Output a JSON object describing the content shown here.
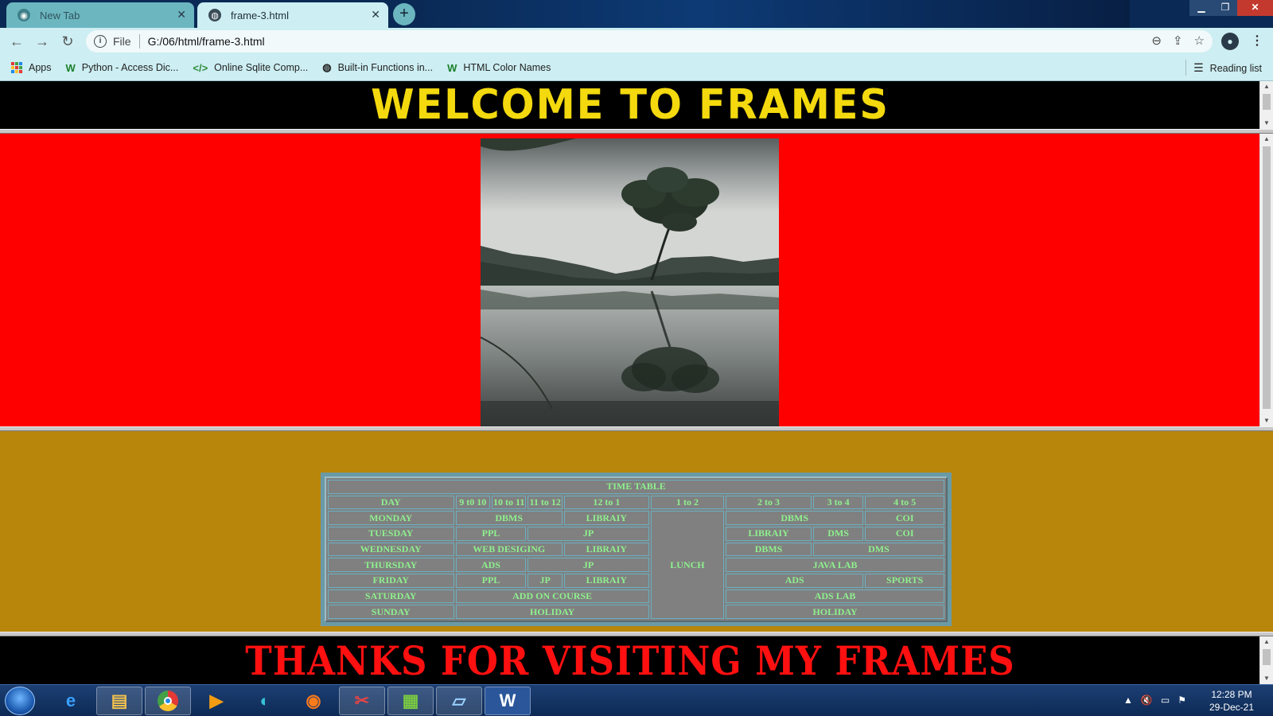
{
  "browser": {
    "tabs": [
      {
        "label": "New Tab"
      },
      {
        "label": "frame-3.html"
      }
    ],
    "address": {
      "scheme_label": "File",
      "url": "G:/06/html/frame-3.html"
    },
    "bookmarks": [
      {
        "label": "Apps"
      },
      {
        "label": "Python - Access Dic..."
      },
      {
        "label": "Online Sqlite Comp..."
      },
      {
        "label": "Built-in Functions in..."
      },
      {
        "label": "HTML Color Names"
      }
    ],
    "reading_list": "Reading list"
  },
  "page": {
    "header_title": "WELCOME TO FRAMES",
    "footer_text": "THANKS FOR VISITING MY FRAMES",
    "colors": {
      "header_text": "#f3d90e",
      "middle_bg": "#ff0000",
      "table_frame_bg": "#b8860b",
      "footer_text": "#ff1010",
      "table_text": "#8ef08e",
      "table_bg": "#808080"
    },
    "timetable": {
      "caption": "TIME TABLE",
      "headers": [
        "DAY",
        "9 t0 10",
        "10 to 11",
        "11 to 12",
        "12 to 1",
        "1 to 2",
        "2 to 3",
        "3 to 4",
        "4 to 5"
      ],
      "lunch": "LUNCH",
      "rows": [
        {
          "day": "MONDAY",
          "cells": [
            "DBMS",
            "LIBRAIY",
            "DBMS",
            "COI"
          ]
        },
        {
          "day": "TUESDAY",
          "cells": [
            "PPL",
            "JP",
            "LIBRAIY",
            "DMS",
            "COI"
          ]
        },
        {
          "day": "WEDNESDAY",
          "cells": [
            "WEB DESIGING",
            "LIBRAIY",
            "DBMS",
            "DMS"
          ]
        },
        {
          "day": "THURSDAY",
          "cells": [
            "ADS",
            "JP",
            "JAVA LAB"
          ]
        },
        {
          "day": "FRIDAY",
          "cells": [
            "PPL",
            "JP",
            "LIBRAIY",
            "ADS",
            "SPORTS"
          ]
        },
        {
          "day": "SATURDAY",
          "cells": [
            "ADD ON COURSE",
            "ADS LAB"
          ]
        },
        {
          "day": "SUNDAY",
          "cells": [
            "HOLIDAY",
            "HOLIDAY"
          ]
        }
      ]
    }
  },
  "taskbar": {
    "apps": [
      "internet-explorer",
      "file-explorer",
      "chrome",
      "media-player",
      "edge",
      "firefox",
      "snipping-tool",
      "task-app",
      "notepad",
      "word"
    ],
    "clock_time": "12:28 PM",
    "clock_date": "29-Dec-21"
  }
}
